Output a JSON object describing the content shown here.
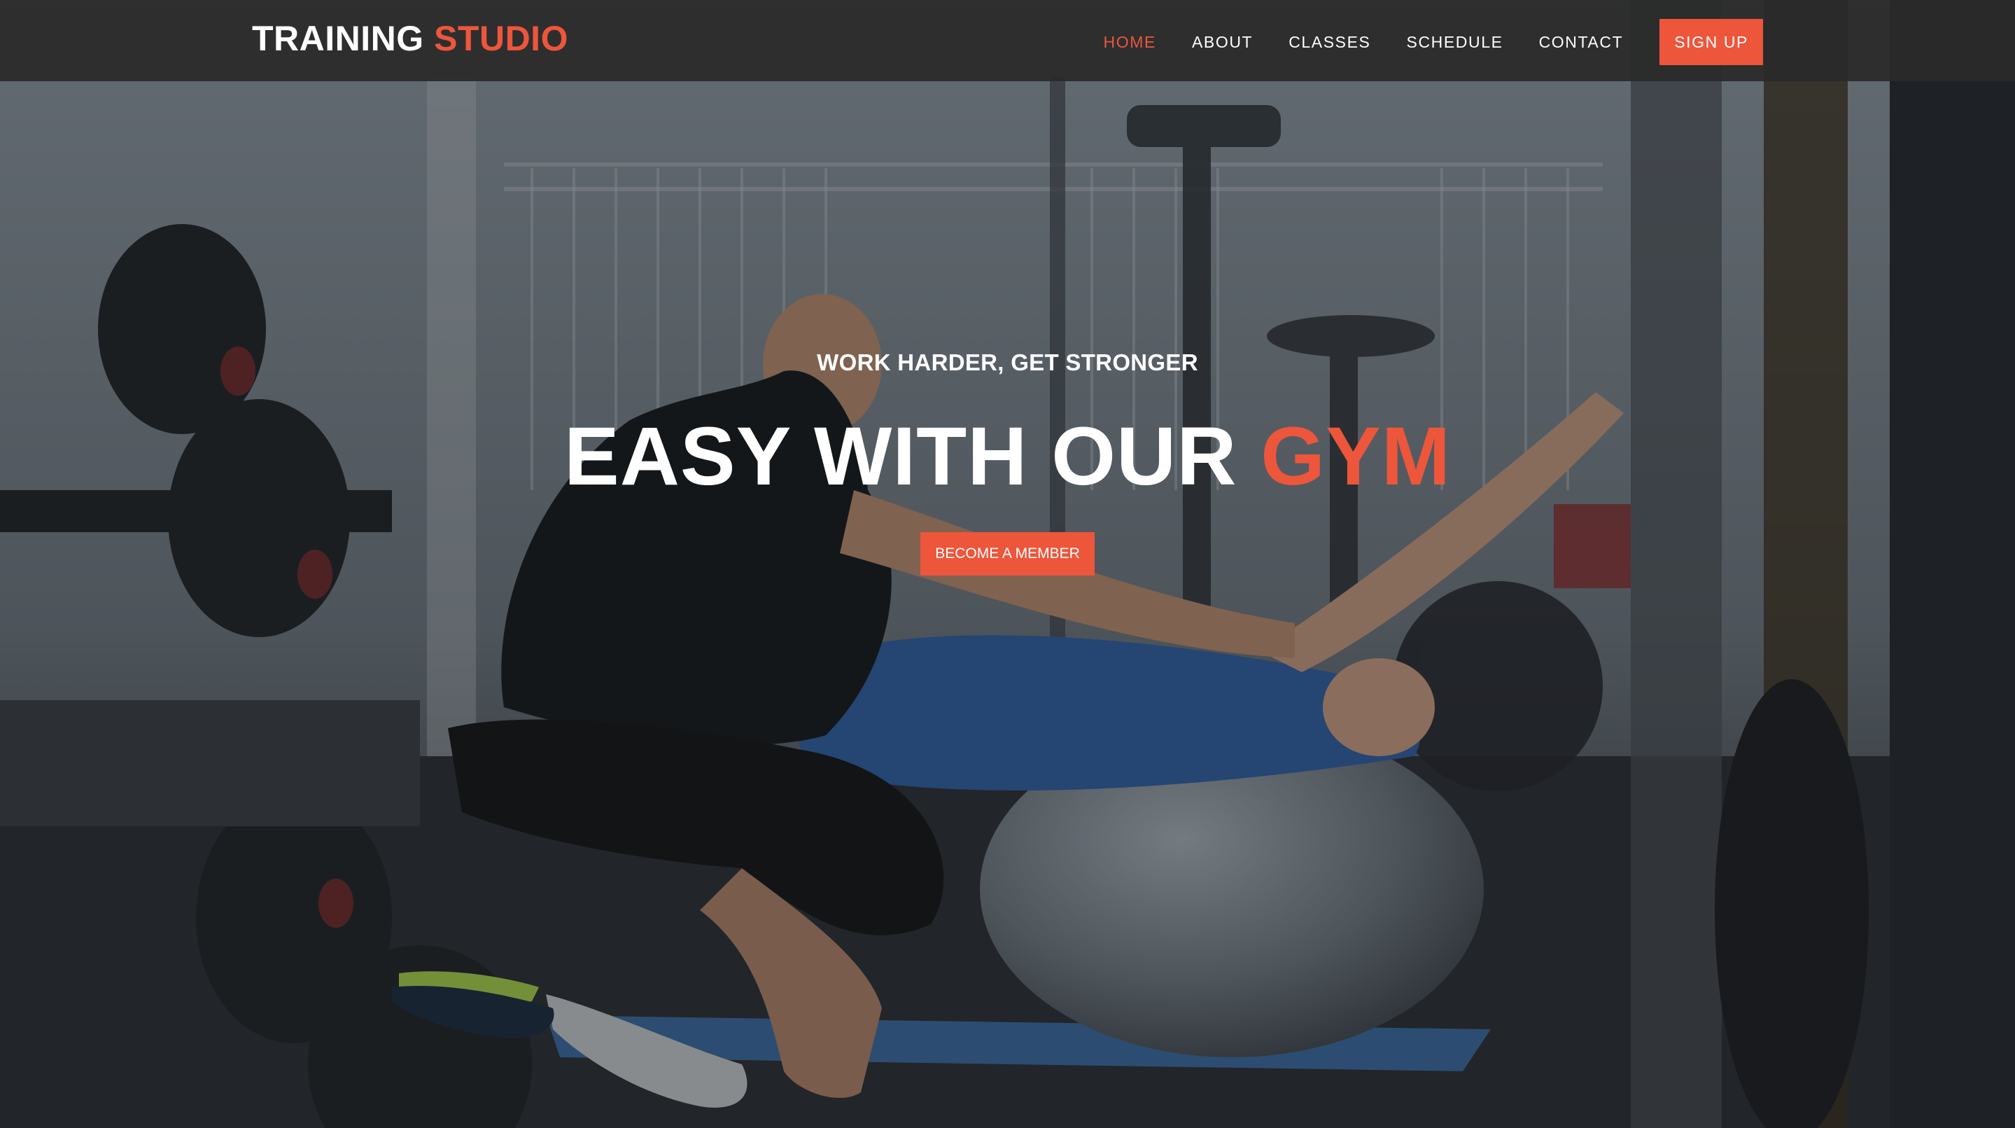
{
  "brand": {
    "primary": "TRAINING",
    "accent": "STUDIO",
    "accent_color": "#ed563b"
  },
  "nav": {
    "items": [
      {
        "label": "HOME",
        "active": true
      },
      {
        "label": "ABOUT",
        "active": false
      },
      {
        "label": "CLASSES",
        "active": false
      },
      {
        "label": "SCHEDULE",
        "active": false
      },
      {
        "label": "CONTACT",
        "active": false
      }
    ],
    "signup_label": "SIGN UP"
  },
  "hero": {
    "subtitle": "WORK HARDER, GET STRONGER",
    "headline_main": "EASY WITH OUR",
    "headline_accent": "GYM",
    "cta_label": "BECOME A MEMBER"
  },
  "colors": {
    "header_bg": "#2a2a2a",
    "accent": "#ed563b",
    "text": "#ffffff"
  }
}
